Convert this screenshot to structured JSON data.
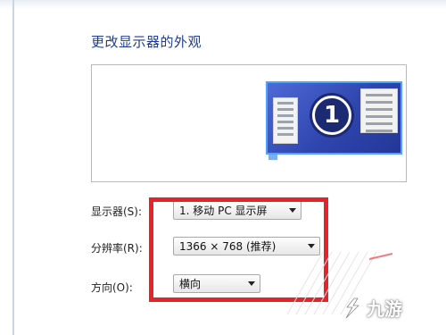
{
  "page": {
    "title": "更改显示器的外观"
  },
  "preview": {
    "monitor_number": "1"
  },
  "settings": {
    "display_label": "显示器(S):",
    "display_value": "1. 移动 PC 显示屏",
    "resolution_label": "分辨率(R):",
    "resolution_value": "1366 × 768 (推荐)",
    "orientation_label": "方向(O):",
    "orientation_value": "横向"
  },
  "watermark": {
    "text": "九游"
  },
  "colors": {
    "title": "#1e3d8f",
    "highlight": "#e8212b",
    "monitor": "#2f45ae"
  }
}
